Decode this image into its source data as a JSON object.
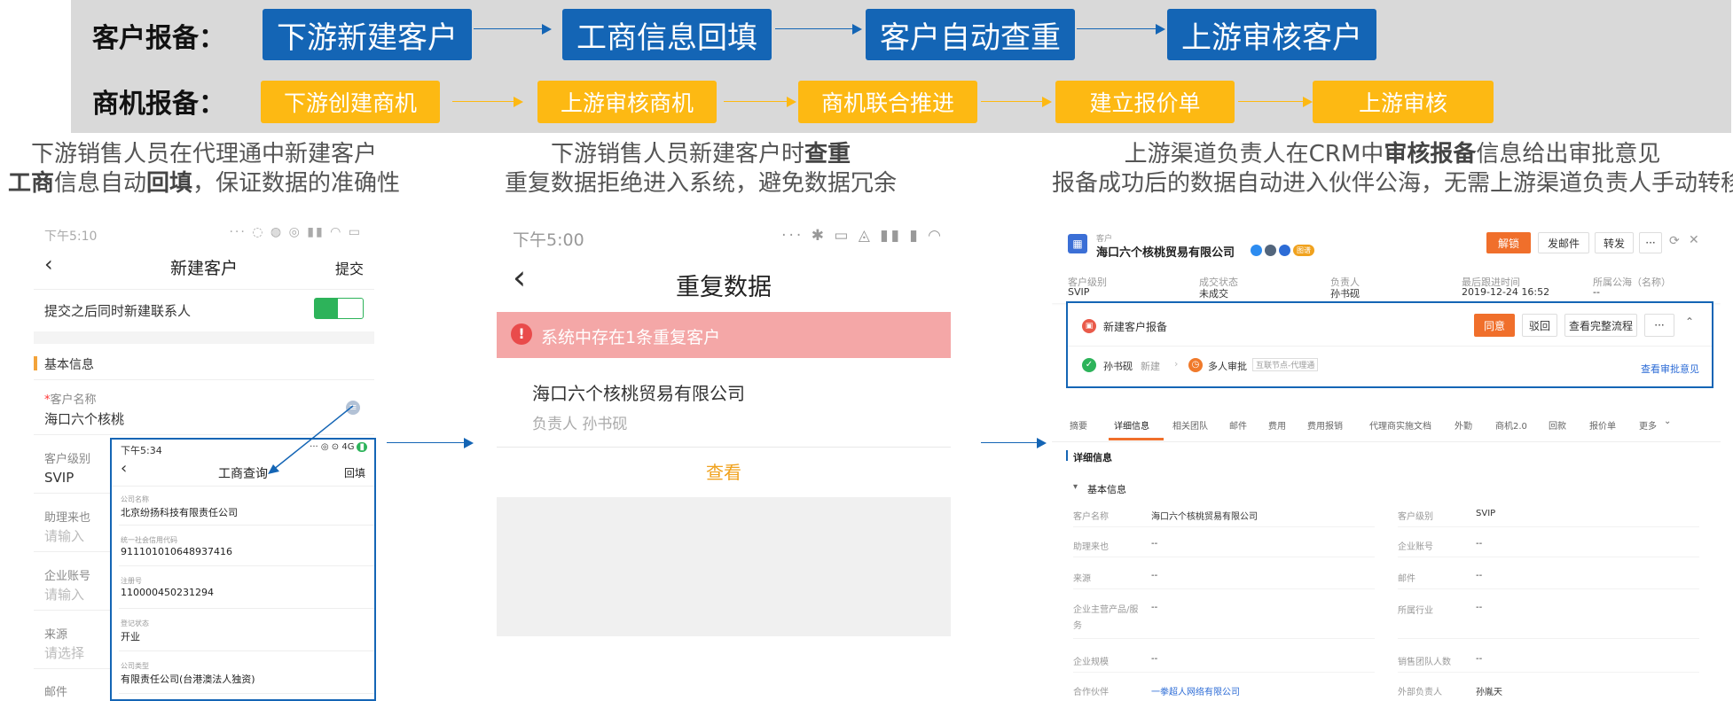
{
  "flow": {
    "row1_label": "客户报备：",
    "row1_steps": [
      "下游新建客户",
      "工商信息回填",
      "客户自动查重",
      "上游审核客户"
    ],
    "row2_label": "商机报备：",
    "row2_steps": [
      "下游创建商机",
      "上游审核商机",
      "商机联合推进",
      "建立报价单",
      "上游审核"
    ]
  },
  "descriptions": {
    "col1": {
      "line1": "下游销售人员在代理通中新建客户",
      "line2_a": "工商",
      "line2_b": "信息自动",
      "line2_c": "回填",
      "line2_d": "，保证数据的准确性"
    },
    "col2": {
      "line1_a": "下游销售人员新建客户时",
      "line1_b": "查重",
      "line2": "重复数据拒绝进入系统，避免数据冗余"
    },
    "col3": {
      "line1_a": "上游渠道负责人在CRM中",
      "line1_b": "审核报备",
      "line1_c": "信息给出审批意见",
      "line2": "报备成功后的数据自动进入伙伴公海，无需上游渠道负责人手动转移"
    }
  },
  "phone1": {
    "time": "下午5:10",
    "title": "新建客户",
    "submit": "提交",
    "toggle_label": "提交之后同时新建联系人",
    "section": "基本信息",
    "required_mark": "*",
    "name_label": "客户名称",
    "name_value": "海口六个核桃",
    "level_label": "客户级别",
    "level_value": "SVIP",
    "assist_label": "助理来也",
    "assist_ph": "请输入",
    "account_label": "企业账号",
    "account_ph": "请输入",
    "source_label": "来源",
    "source_ph": "请选择",
    "email_label": "邮件"
  },
  "popup": {
    "time": "下午5:34",
    "status": "4G",
    "title": "工商查询",
    "fill": "回填",
    "fields": [
      {
        "label": "公司名称",
        "value": "北京纷扬科技有限责任公司"
      },
      {
        "label": "统一社会信用代码",
        "value": "911101010648937416"
      },
      {
        "label": "注册号",
        "value": "110000450231294"
      },
      {
        "label": "登记状态",
        "value": "开业"
      },
      {
        "label": "公司类型",
        "value": "有限责任公司(台港澳法人独资)"
      }
    ]
  },
  "phone2": {
    "time": "下午5:00",
    "title": "重复数据",
    "alert": "系统中存在1条重复客户",
    "company": "海口六个核桃贸易有限公司",
    "owner_label": "负责人",
    "owner": "孙书砚",
    "view": "查看"
  },
  "crm": {
    "type_label": "客户",
    "company": "海口六个核桃贸易有限公司",
    "tag": "图谱",
    "btn_unlock": "解锁",
    "btn_mail": "发邮件",
    "btn_transfer": "转发",
    "btn_more": "···",
    "info": [
      {
        "label": "客户级别",
        "value": "SVIP"
      },
      {
        "label": "成交状态",
        "value": "未成交"
      },
      {
        "label": "负责人",
        "value": "孙书砚"
      },
      {
        "label": "最后跟进时间",
        "value": "2019-12-24 16:52"
      },
      {
        "label": "所属公海（名称）",
        "value": "--"
      }
    ],
    "approval_title": "新建客户报备",
    "btn_agree": "同意",
    "btn_reject": "驳回",
    "btn_flow": "查看完整流程",
    "step1_name": "孙书砚",
    "step1_action": "新建",
    "step2_name": "多人审批",
    "step2_tag": "互联节点-代理通",
    "view_opinion": "查看审批意见",
    "tabs": [
      "摘要",
      "详细信息",
      "相关团队",
      "邮件",
      "费用",
      "费用报销",
      "代理商实施文档",
      "外勤",
      "商机2.0",
      "回款",
      "报价单",
      "更多"
    ],
    "detail_title": "详细信息",
    "basic_title": "基本信息",
    "fields_left": [
      {
        "label": "客户名称",
        "value": "海口六个核桃贸易有限公司"
      },
      {
        "label": "助理来也",
        "value": "--"
      },
      {
        "label": "来源",
        "value": "--"
      },
      {
        "label": "企业主营产品/服务",
        "value": "--"
      },
      {
        "label": "企业规模",
        "value": "--"
      },
      {
        "label": "合作伙伴",
        "value": "一拳超人网络有限公司"
      }
    ],
    "fields_right": [
      {
        "label": "客户级别",
        "value": "SVIP"
      },
      {
        "label": "企业账号",
        "value": "--"
      },
      {
        "label": "邮件",
        "value": "--"
      },
      {
        "label": "所属行业",
        "value": "--"
      },
      {
        "label": "销售团队人数",
        "value": "--"
      },
      {
        "label": "外部负责人",
        "value": "孙胤天"
      }
    ]
  },
  "colors": {
    "blue": "#1465b5",
    "yellow": "#fdb913",
    "orange": "#f06f2b",
    "alert_bg": "#f4a7a7",
    "green": "#2db35a"
  }
}
